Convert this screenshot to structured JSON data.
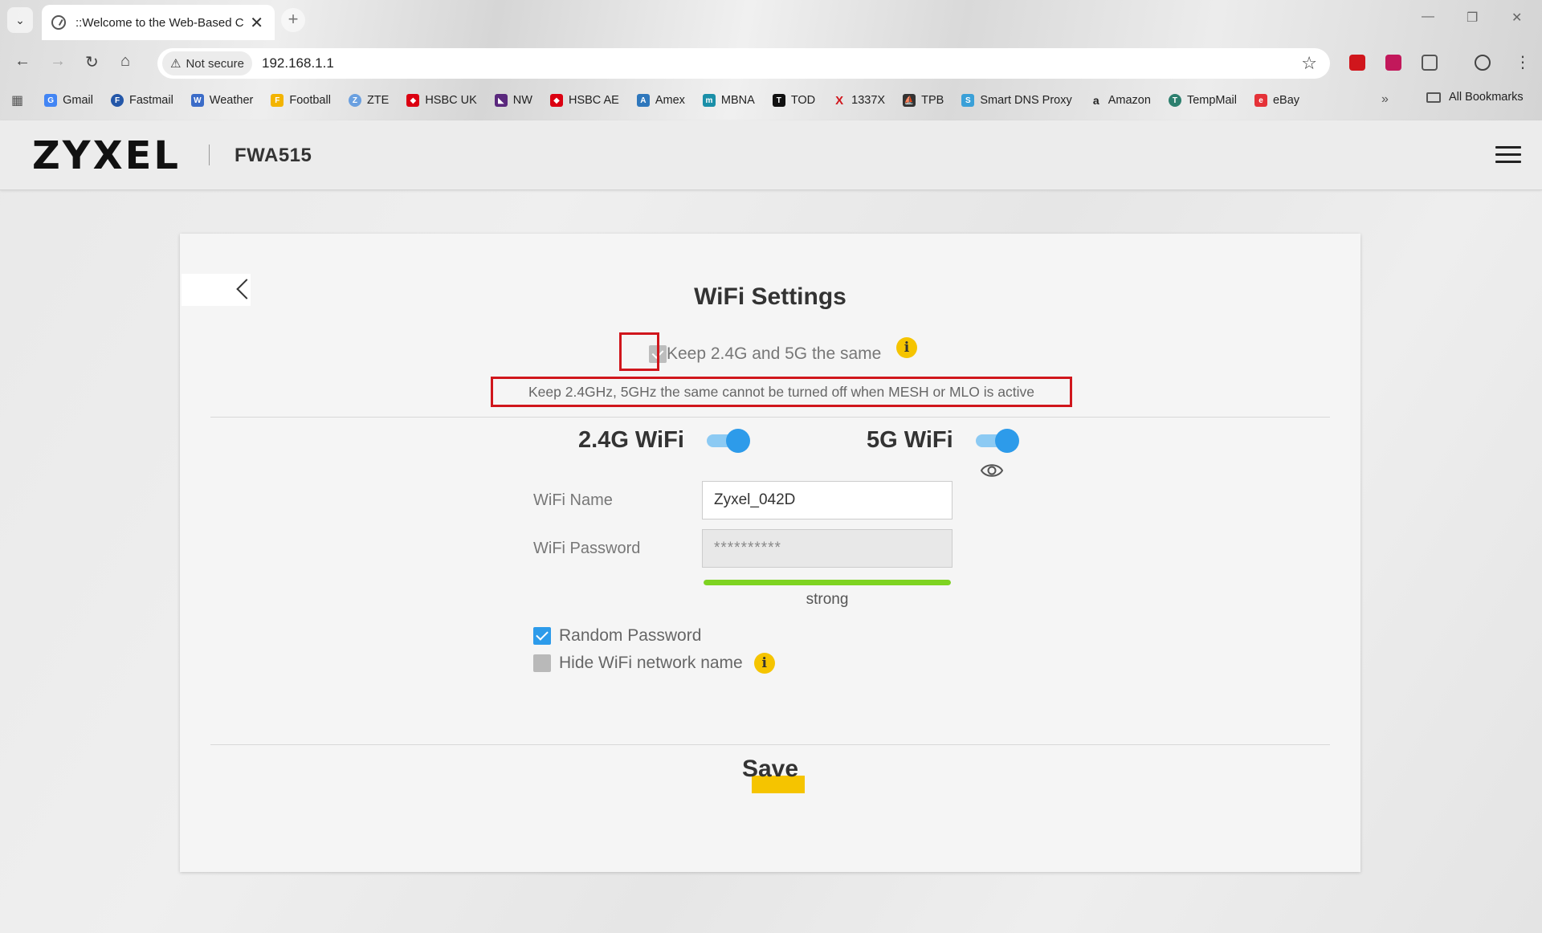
{
  "browser": {
    "tab_title": "::Welcome to the Web-Based C",
    "security_chip": "Not secure",
    "url": "192.168.1.1",
    "bookmarks": [
      {
        "label": "Gmail",
        "icon": "google-icon",
        "color": "#4285f4"
      },
      {
        "label": "Fastmail",
        "icon": "fastmail-icon",
        "color": "#2457a8"
      },
      {
        "label": "Weather",
        "icon": "weather-icon",
        "color": "#3b6cc8"
      },
      {
        "label": "Football",
        "icon": "football-icon",
        "color": "#f3b400"
      },
      {
        "label": "ZTE",
        "icon": "zte-icon",
        "color": "#6aa0e0"
      },
      {
        "label": "HSBC UK",
        "icon": "hsbc-icon",
        "color": "#db0011"
      },
      {
        "label": "NW",
        "icon": "natwest-icon",
        "color": "#5a287d"
      },
      {
        "label": "HSBC AE",
        "icon": "hsbc-icon",
        "color": "#db0011"
      },
      {
        "label": "Amex",
        "icon": "amex-icon",
        "color": "#2e77bc"
      },
      {
        "label": "MBNA",
        "icon": "mbna-icon",
        "color": "#1a8fa8"
      },
      {
        "label": "TOD",
        "icon": "tod-icon",
        "color": "#111111"
      },
      {
        "label": "1337X",
        "icon": "x-icon",
        "color": "#d0161c"
      },
      {
        "label": "TPB",
        "icon": "ship-icon",
        "color": "#333333"
      },
      {
        "label": "Smart DNS Proxy",
        "icon": "dns-icon",
        "color": "#3aa0d8"
      },
      {
        "label": "Amazon",
        "icon": "amazon-icon",
        "color": "#222222"
      },
      {
        "label": "TempMail",
        "icon": "tempmail-icon",
        "color": "#2c7f6e"
      },
      {
        "label": "eBay",
        "icon": "ebay-icon",
        "color": "#e53238"
      }
    ],
    "bookmarks_more": "»",
    "all_bookmarks": "All Bookmarks"
  },
  "router": {
    "brand": "ZYXEL",
    "model": "FWA515"
  },
  "wifi": {
    "title": "WiFi Settings",
    "keep_same_label": "Keep 2.4G and 5G the same",
    "keep_same_warning": "Keep 2.4GHz, 5GHz the same cannot be turned off when MESH or MLO is active",
    "band_24_label": "2.4G WiFi",
    "band_5_label": "5G WiFi",
    "name_label": "WiFi Name",
    "name_value": "Zyxel_042D",
    "password_label": "WiFi Password",
    "password_value": "**********",
    "strength_text": "strong",
    "strength_level": 1.0,
    "random_password_label": "Random Password",
    "hide_name_label": "Hide WiFi network name",
    "save_label": "Save"
  },
  "colors": {
    "accent_blue": "#2d9bea",
    "brand_yellow": "#f5c400",
    "highlight_red": "#d0161c",
    "strength_green": "#7ed321"
  }
}
